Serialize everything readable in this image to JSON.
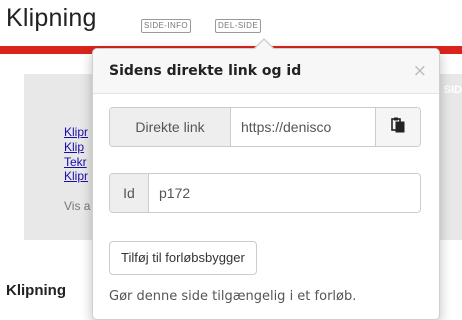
{
  "page": {
    "title": "Klipning",
    "buttons": [
      "SIDE-INFO",
      "DEL-SIDE"
    ],
    "panel_hint": "SID"
  },
  "background": {
    "links": [
      "Klipr",
      "Klip",
      "Tekr",
      "Klipr"
    ],
    "vis_text": "Vis a",
    "section_heading": "Klipning"
  },
  "popover": {
    "title": "Sidens direkte link og id",
    "close_symbol": "×",
    "link_label": "Direkte link",
    "link_value": "https://denisco",
    "id_label": "Id",
    "id_value": "p172",
    "add_button": "Tilføj til forløbsbygger",
    "help_text": "Gør denne side tilgængelig i et forløb."
  },
  "colors": {
    "accent_red": "#d9251d",
    "panel_gray": "#e8e8e8"
  },
  "icons": {
    "copy": "clipboard-copy-icon"
  }
}
